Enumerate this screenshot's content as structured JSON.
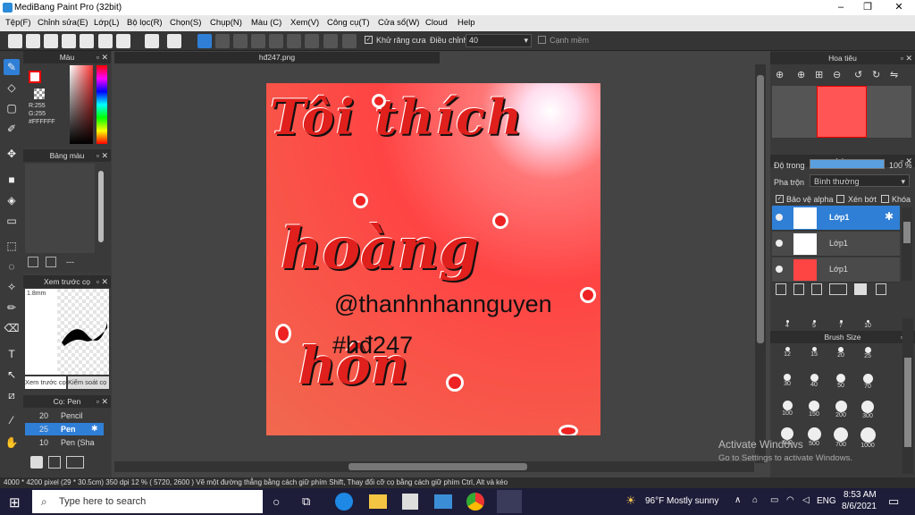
{
  "window": {
    "title": "MediBang Paint Pro (32bit)"
  },
  "menu": [
    "Tệp(F)",
    "Chỉnh sửa(E)",
    "Lớp(L)",
    "Bộ lọc(R)",
    "Chọn(S)",
    "Chụp(N)",
    "Màu (C)",
    "Xem(V)",
    "Công cụ(T)",
    "Cửa sổ(W)",
    "Cloud",
    "Help"
  ],
  "toolbar": {
    "antialias_label": "Khử răng cưa",
    "adjust_label": "Điều chỉnh",
    "adjust_value": "40",
    "snap_label": "Cạnh mềm"
  },
  "color_panel": {
    "title": "Màu",
    "r": "R:255",
    "g": "G:255",
    "hex": "#FFFFFF"
  },
  "palette_panel": {
    "title": "Bảng màu",
    "dash": "---"
  },
  "preview_panel": {
    "title": "Xem trước cọ",
    "size": "1.8mm",
    "tab1": "Xem trước cọ",
    "tab2": "Kiểm soát cọ"
  },
  "brush_panel": {
    "title": "Cọ: Pen",
    "items": [
      {
        "size": "20",
        "name": "Pencil"
      },
      {
        "size": "25",
        "name": "Pen"
      },
      {
        "size": "10",
        "name": "Pen (Sha"
      }
    ]
  },
  "canvas": {
    "tab": "hđ247.png",
    "text1": "Tôi thích",
    "text2": "hoàng",
    "text3": "hôn",
    "credit": "@thanhnhannguyen",
    "tag": "#hđ247"
  },
  "navigator": {
    "title": "Hoa tiêu"
  },
  "layers": {
    "title": "Lớp",
    "opacity_label": "Độ trong",
    "opacity_value": "100 %",
    "blend_label": "Pha trộn",
    "blend_value": "Bình thường",
    "alpha": "Bảo vệ alpha",
    "clip": "Xén bớt",
    "lock": "Khóa",
    "rows": [
      "Lớp1",
      "Lớp1",
      "Lớp1"
    ]
  },
  "brushsize": {
    "title": "Brush Size",
    "sizes": [
      "4",
      "5",
      "7",
      "10",
      "12",
      "15",
      "20",
      "25",
      "30",
      "40",
      "50",
      "70",
      "100",
      "150",
      "200",
      "300",
      "400",
      "500",
      "700",
      "1000"
    ]
  },
  "status": {
    "text": "4000 * 4200 pixel   (29 * 30.5cm)   350 dpi   12 %   ( 5720, 2600 )   Vẽ một đường thẳng bằng cách giữ phím Shift, Thay đổi cỡ cọ bằng cách giữ phím Ctrl, Alt và kéo"
  },
  "watermark": {
    "line1": "Activate Windows",
    "line2": "Go to Settings to activate Windows."
  },
  "taskbar": {
    "search_placeholder": "Type here to search",
    "weather": "96°F  Mostly sunny",
    "lang": "ENG",
    "time": "8:53 AM",
    "date": "8/6/2021"
  }
}
